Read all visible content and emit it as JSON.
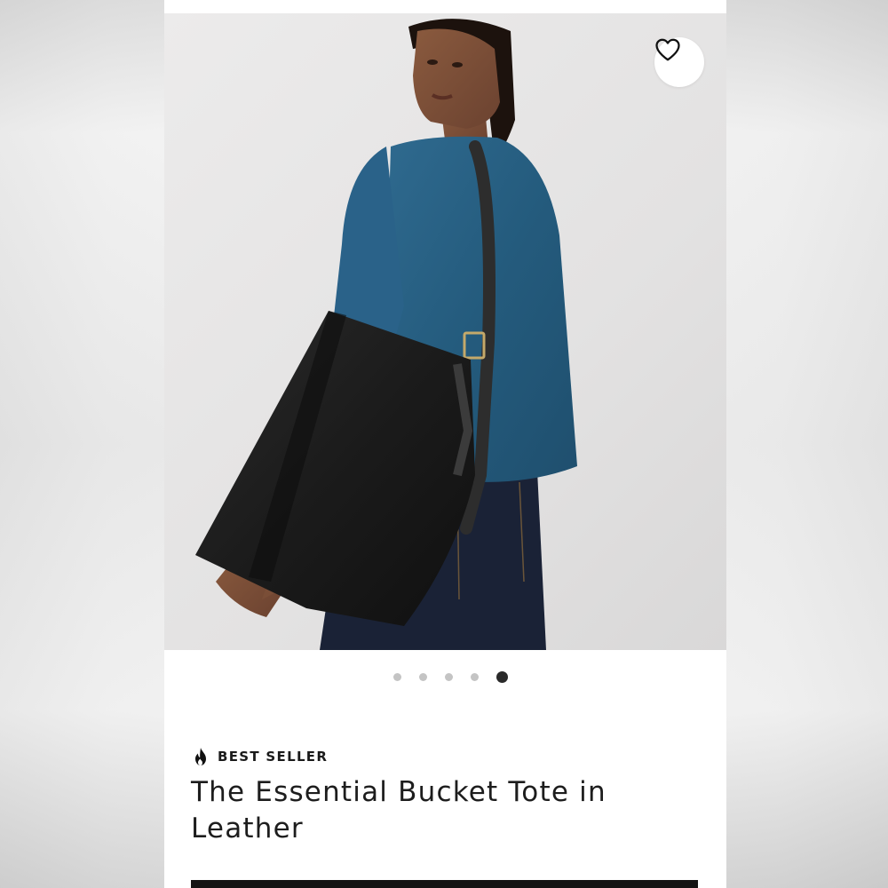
{
  "product": {
    "badge": {
      "icon": "flame-icon",
      "label": "BEST SELLER"
    },
    "title": "The Essential Bucket Tote in Leather",
    "image": {
      "alt": "Model wearing a blue fuzzy cardigan and dark jeans carrying a black leather bucket tote on her shoulder"
    },
    "favorite_icon": "heart-outline-icon"
  },
  "carousel": {
    "slide_count": 5,
    "active_slide": 5
  },
  "colors": {
    "accent": "#141414",
    "dot_inactive": "#c4c4c4",
    "dot_active": "#2a2a2a"
  }
}
